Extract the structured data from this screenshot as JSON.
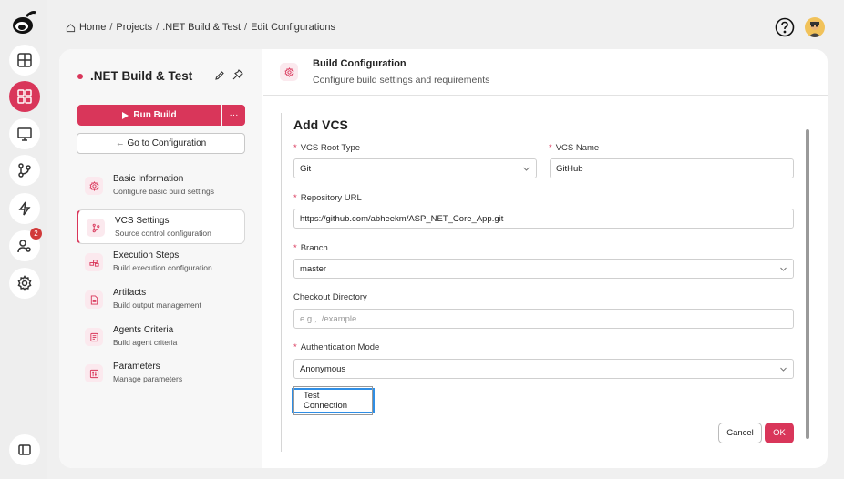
{
  "breadcrumb": {
    "home": "Home",
    "items": [
      "Projects",
      ".NET Build & Test",
      "Edit Configurations"
    ],
    "separator": "/"
  },
  "rail": {
    "notifications_count": "2",
    "icons": [
      "logo-icon",
      "dashboard-icon",
      "apps-icon",
      "monitor-icon",
      "git-branch-icon",
      "lightning-icon",
      "user-settings-icon",
      "settings-icon",
      "sidebar-toggle-icon"
    ],
    "active": "apps-icon"
  },
  "project": {
    "title": ".NET Build & Test",
    "run_label": "Run Build",
    "more_label": "···",
    "goto_label": "← Go to Configuration"
  },
  "nav": [
    {
      "title": "Basic Information",
      "sub": "Configure basic build settings",
      "icon": "gear-icon"
    },
    {
      "title": "VCS Settings",
      "sub": "Source control configuration",
      "icon": "git-branch-icon"
    },
    {
      "title": "Execution Steps",
      "sub": "Build execution configuration",
      "icon": "steps-icon"
    },
    {
      "title": "Artifacts",
      "sub": "Build output management",
      "icon": "file-icon"
    },
    {
      "title": "Agents Criteria",
      "sub": "Build agent criteria",
      "icon": "agent-icon"
    },
    {
      "title": "Parameters",
      "sub": "Manage parameters",
      "icon": "sliders-icon"
    }
  ],
  "nav_active_index": 1,
  "header": {
    "title": "Build Configuration",
    "subtitle": "Configure build settings and requirements"
  },
  "form": {
    "title": "Add VCS",
    "vcs_root_type_label": "VCS Root Type",
    "vcs_root_type_value": "Git",
    "vcs_name_label": "VCS Name",
    "vcs_name_value": "GitHub",
    "repo_url_label": "Repository URL",
    "repo_url_value": "https://github.com/abheekm/ASP_NET_Core_App.git",
    "branch_label": "Branch",
    "branch_value": "master",
    "checkout_label": "Checkout Directory",
    "checkout_placeholder": "e.g., ./example",
    "auth_label": "Authentication Mode",
    "auth_value": "Anonymous",
    "required_mark": "*",
    "test_label": "Test Connection",
    "cancel_label": "Cancel",
    "ok_label": "OK"
  },
  "colors": {
    "accent": "#d9365a",
    "focus": "#2f8ee5"
  }
}
